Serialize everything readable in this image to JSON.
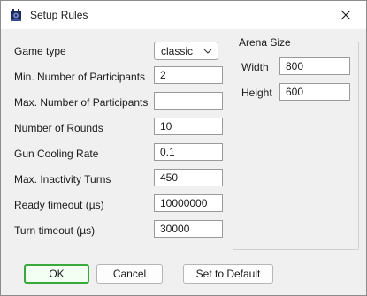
{
  "window": {
    "title": "Setup Rules"
  },
  "rules": [
    {
      "label": "Game type",
      "value": "classic",
      "kind": "select"
    },
    {
      "label": "Min. Number of Participants",
      "value": "2"
    },
    {
      "label": "Max. Number of Participants",
      "value": ""
    },
    {
      "label": "Number of Rounds",
      "value": "10"
    },
    {
      "label": "Gun Cooling Rate",
      "value": "0.1"
    },
    {
      "label": "Max. Inactivity Turns",
      "value": "450"
    },
    {
      "label": "Ready timeout (µs)",
      "value": "10000000"
    },
    {
      "label": "Turn timeout (µs)",
      "value": "30000"
    }
  ],
  "arena": {
    "group_label": "Arena Size",
    "width_label": "Width",
    "width_value": "800",
    "height_label": "Height",
    "height_value": "600"
  },
  "buttons": {
    "ok": "OK",
    "cancel": "Cancel",
    "default": "Set to Default"
  },
  "colors": {
    "default_button_border": "#3aa83a"
  }
}
